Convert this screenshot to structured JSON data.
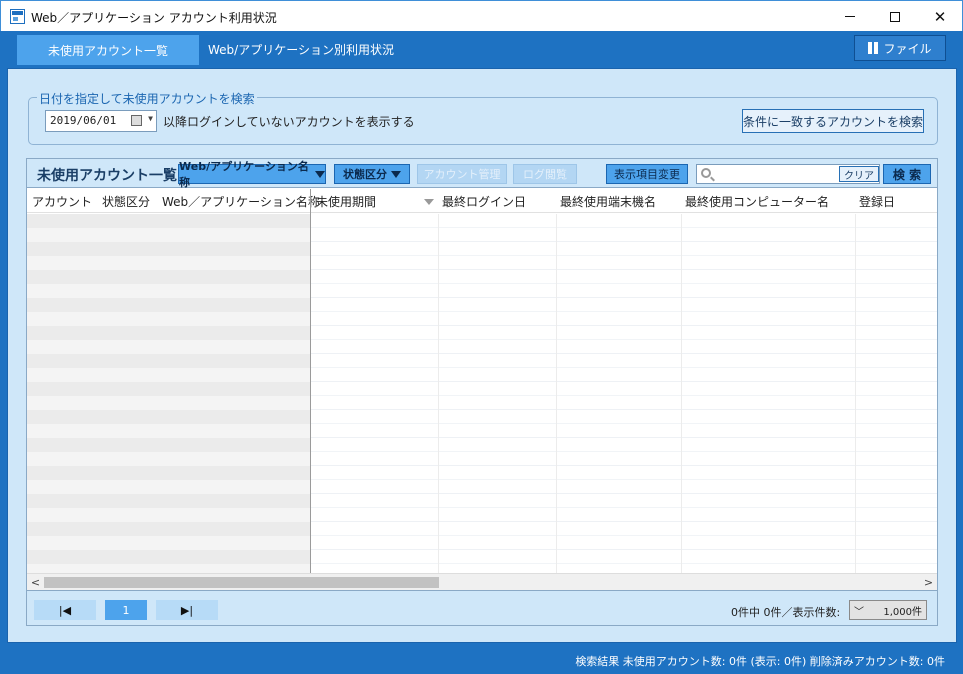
{
  "window": {
    "title": "Web／アプリケーション アカウント利用状況",
    "min_label": "",
    "max_label": "",
    "close_label": "✕"
  },
  "tabs": {
    "active_label": "未使用アカウント一覧",
    "other_label": "Web/アプリケーション別利用状況",
    "file_label": "ファイル"
  },
  "search": {
    "legend": "日付を指定して未使用アカウントを検索",
    "date_value": "2019/06/01",
    "date_dropdown": "▼",
    "description": "以降ログインしていないアカウントを表示する",
    "search_button": "条件に一致するアカウントを検索"
  },
  "list": {
    "title": "未使用アカウント一覧",
    "filter_app_label": "Web/アプリケーション名称",
    "filter_status_label": "状態区分",
    "account_manage_label": "アカウント管理",
    "log_view_label": "ログ閲覧",
    "columns_change_label": "表示項目変更",
    "search_placeholder": "",
    "clear_label": "クリア",
    "exec_label": "検 索"
  },
  "columns": [
    "アカウント",
    "状態区分",
    "Web／アプリケーション名称",
    "未使用期間",
    "最終ログイン日",
    "最終使用端末機名",
    "最終使用コンピューター名",
    "登録日"
  ],
  "scroll": {
    "left_arrow": "<",
    "right_arrow": ">"
  },
  "pager": {
    "first_label": "|◀",
    "current_page": "1",
    "last_label": "▶|",
    "info": "0件中 0件／表示件数:",
    "count_arrow": "﹀",
    "count_value": "1,000件"
  },
  "status": {
    "text": "検索結果 未使用アカウント数: 0件 (表示: 0件) 削除済みアカウント数: 0件"
  },
  "colors": {
    "brand": "#1e72c2",
    "accent": "#4da3ec",
    "panel": "#cfe7f9"
  }
}
